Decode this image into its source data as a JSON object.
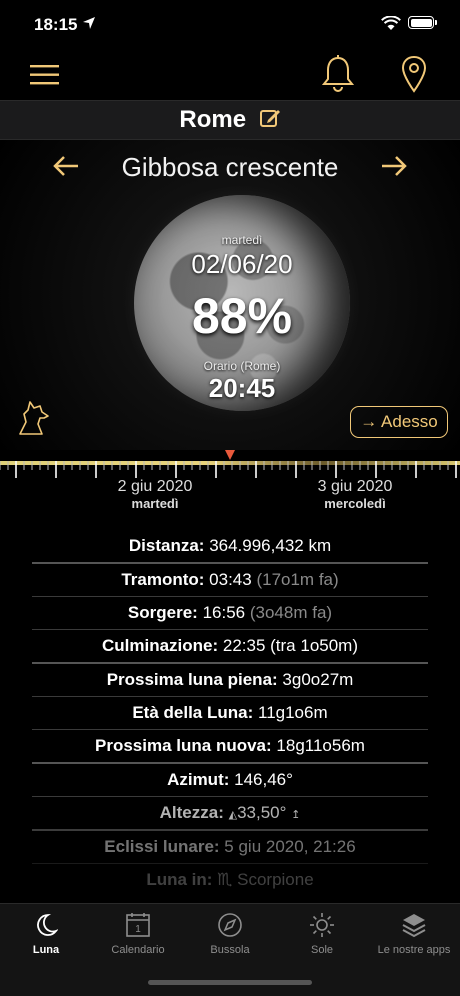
{
  "status": {
    "time": "18:15"
  },
  "city": {
    "name": "Rome"
  },
  "moon": {
    "phase_name": "Gibbosa crescente",
    "weekday": "martedì",
    "date": "02/06/20",
    "illumination": "88%",
    "time_label": "Orario (Rome)",
    "time": "20:45",
    "now_button": "→ Adesso"
  },
  "timeline": {
    "date1": "2 giu 2020",
    "weekday1": "martedì",
    "date2": "3 giu 2020",
    "weekday2": "mercoledì"
  },
  "info": {
    "distanza": {
      "label": "Distanza:",
      "value": "364.996,432 km"
    },
    "tramonto": {
      "label": "Tramonto:",
      "value": "03:43",
      "sub": "(17o1m fa)"
    },
    "sorgere": {
      "label": "Sorgere:",
      "value": "16:56",
      "sub": "(3o48m fa)"
    },
    "culminazione": {
      "label": "Culminazione:",
      "value": "22:35 (tra 1o50m)"
    },
    "luna_piena": {
      "label": "Prossima luna piena:",
      "value": "3g0o27m"
    },
    "eta": {
      "label": "Età della Luna:",
      "value": "11g1o6m"
    },
    "luna_nuova": {
      "label": "Prossima luna nuova:",
      "value": "18g11o56m"
    },
    "azimut": {
      "label": "Azimut:",
      "value": "146,46°"
    },
    "altezza": {
      "label": "Altezza:",
      "value": "33,50°"
    },
    "eclissi": {
      "label": "Eclissi lunare:",
      "value": "5 giu 2020, 21:26"
    },
    "luna_in": {
      "label": "Luna in:",
      "value": "♏ Scorpione"
    }
  },
  "tabs": [
    {
      "label": "Luna",
      "icon": "moon-icon"
    },
    {
      "label": "Calendario",
      "icon": "calendar-icon"
    },
    {
      "label": "Bussola",
      "icon": "compass-icon"
    },
    {
      "label": "Sole",
      "icon": "sun-icon"
    },
    {
      "label": "Le nostre apps",
      "icon": "layers-icon"
    }
  ],
  "colors": {
    "accent": "#f1c878",
    "background": "#000000",
    "timeline_marker": "#e8593c"
  }
}
